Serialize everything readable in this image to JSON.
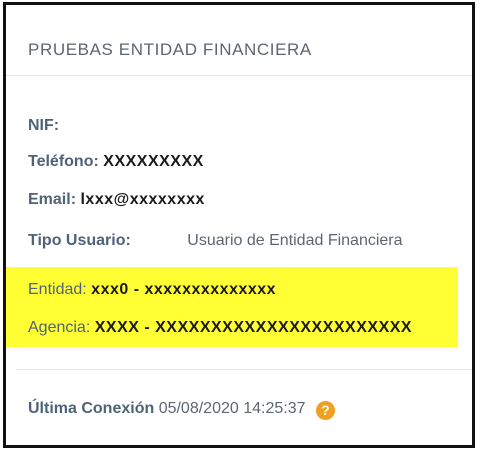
{
  "panel": {
    "title": "PRUEBAS ENTIDAD FINANCIERA"
  },
  "fields": {
    "nif": {
      "label": "NIF:",
      "value": ""
    },
    "telefono": {
      "label": "Teléfono:",
      "value": "XXXXXXXXX"
    },
    "email": {
      "label": "Email:",
      "value": "lxxx@xxxxxxxx"
    },
    "tipo_usuario": {
      "label": "Tipo Usuario:",
      "value": "Usuario de Entidad Financiera"
    },
    "entidad": {
      "label": "Entidad:",
      "value": "xxx0 - xxxxxxxxxxxxxx"
    },
    "agencia": {
      "label": "Agencia:",
      "value": "XXXX - XXXXXXXXXXXXXXXXXXXXXXX"
    },
    "ultima_conexion": {
      "label": "Última Conexión",
      "value": "05/08/2020 14:25:37"
    }
  },
  "icons": {
    "help": "question-circle-icon",
    "help_glyph": "?"
  },
  "colors": {
    "highlight": "#ffff33",
    "help_icon": "#f0a020",
    "border": "#111111"
  }
}
